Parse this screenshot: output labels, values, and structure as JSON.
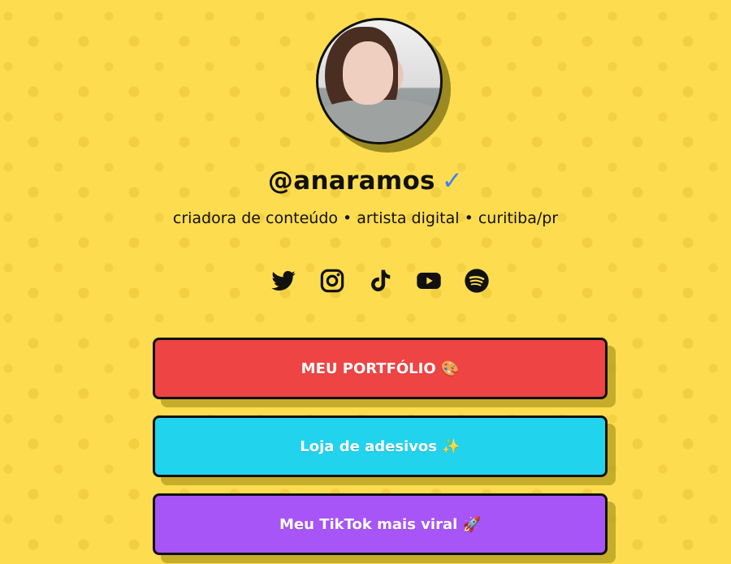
{
  "profile": {
    "username": "@anaramos",
    "verified_mark": "✓",
    "bio": "criadora de conteúdo • artista digital • curitiba/pr"
  },
  "colors": {
    "background": "#fddc4f",
    "verified": "#3b82f6",
    "portfolio": "#ef4444",
    "stickers": "#22d3ee",
    "tiktok": "#a855f7"
  },
  "socials": [
    {
      "icon": "twitter-icon"
    },
    {
      "icon": "instagram-icon"
    },
    {
      "icon": "tiktok-icon"
    },
    {
      "icon": "youtube-icon"
    },
    {
      "icon": "spotify-icon"
    }
  ],
  "links": [
    {
      "label": "MEU PORTFÓLIO 🎨",
      "color": "#ef4444"
    },
    {
      "label": "Loja de adesivos ✨",
      "color": "#22d3ee"
    },
    {
      "label": "Meu TikTok mais viral 🚀",
      "color": "#a855f7"
    }
  ]
}
